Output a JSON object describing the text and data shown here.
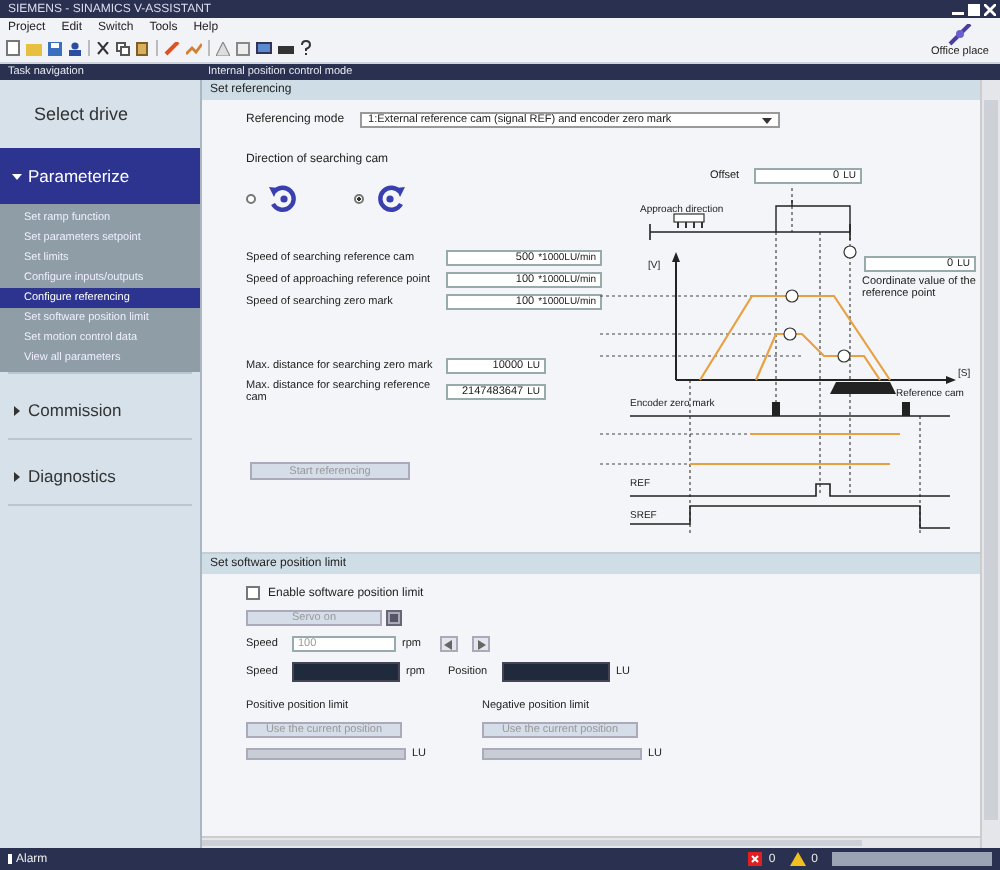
{
  "window": {
    "title": "SIEMENS - SINAMICS V-ASSISTANT"
  },
  "menu": [
    "Project",
    "Edit",
    "Switch",
    "Tools",
    "Help"
  ],
  "toolbar": {
    "status_label": "Office place"
  },
  "task_navigation": {
    "title": "Task navigation",
    "steps": [
      {
        "label": "Select drive",
        "kind": "page",
        "selected": false
      },
      {
        "label": "Parameterize",
        "kind": "group",
        "selected": true,
        "expanded": true,
        "children": [
          {
            "label": "Set ramp function",
            "selected": false
          },
          {
            "label": "Set parameters setpoint",
            "selected": false
          },
          {
            "label": "Set limits",
            "selected": false
          },
          {
            "label": "Configure inputs/outputs",
            "selected": false
          },
          {
            "label": "Configure referencing",
            "selected": true
          },
          {
            "label": "Set software position limit",
            "selected": false
          },
          {
            "label": "Set motion control data",
            "selected": false
          },
          {
            "label": "View all parameters",
            "selected": false
          }
        ]
      },
      {
        "label": "Commission",
        "kind": "group",
        "selected": false,
        "expanded": false
      },
      {
        "label": "Diagnostics",
        "kind": "group",
        "selected": false,
        "expanded": false
      }
    ]
  },
  "mode_title": "Internal position control mode",
  "referencing": {
    "title": "Set referencing",
    "mode_label": "Referencing mode",
    "mode_value": "1:External reference cam (signal REF) and encoder zero mark",
    "direction_label": "Direction of searching cam",
    "directions": [
      {
        "kind": "ccw",
        "selected": false
      },
      {
        "kind": "cw",
        "selected": true
      }
    ],
    "speeds": [
      {
        "label": "Speed of searching reference cam",
        "value": "500",
        "unit": "*1000LU/min"
      },
      {
        "label": "Speed of approaching reference point",
        "value": "100",
        "unit": "*1000LU/min"
      },
      {
        "label": "Speed of searching zero mark",
        "value": "100",
        "unit": "*1000LU/min"
      }
    ],
    "distances": [
      {
        "label": "Max. distance for searching zero mark",
        "value": "10000",
        "unit": "LU"
      },
      {
        "label": "Max. distance for searching reference cam",
        "value": "2147483647",
        "unit": "LU"
      }
    ],
    "offset": {
      "label": "Offset",
      "value": "0",
      "unit": "LU"
    },
    "coordinate": {
      "value": "0",
      "unit": "LU",
      "label": "Coordinate value of the reference point"
    },
    "diagram": {
      "approach": "Approach direction",
      "v_axis": "[V]",
      "s_axis": "[S]",
      "cam": "Reference cam",
      "zero_mark": "Encoder zero mark",
      "ref": "REF",
      "sref": "SREF"
    },
    "start_button": {
      "label": "Start referencing",
      "disabled": true
    }
  },
  "software_limit": {
    "title": "Set software position limit",
    "enable": {
      "label": "Enable software position limit",
      "checked": false
    },
    "servo_button": {
      "label": "Servo on",
      "disabled": true
    },
    "jog": {
      "label": "Speed",
      "placeholder": "100",
      "unit": "rpm"
    },
    "actual": [
      {
        "label": "Speed",
        "unit": "rpm"
      },
      {
        "label": "Position",
        "unit": "LU"
      }
    ],
    "limits": [
      {
        "label": "Positive position limit",
        "button": "Use the current position",
        "unit": "LU"
      },
      {
        "label": "Negative position limit",
        "button": "Use the current position",
        "unit": "LU"
      }
    ]
  },
  "status_bar": {
    "alarm": "Alarm",
    "errors": "0",
    "warnings": "0"
  }
}
